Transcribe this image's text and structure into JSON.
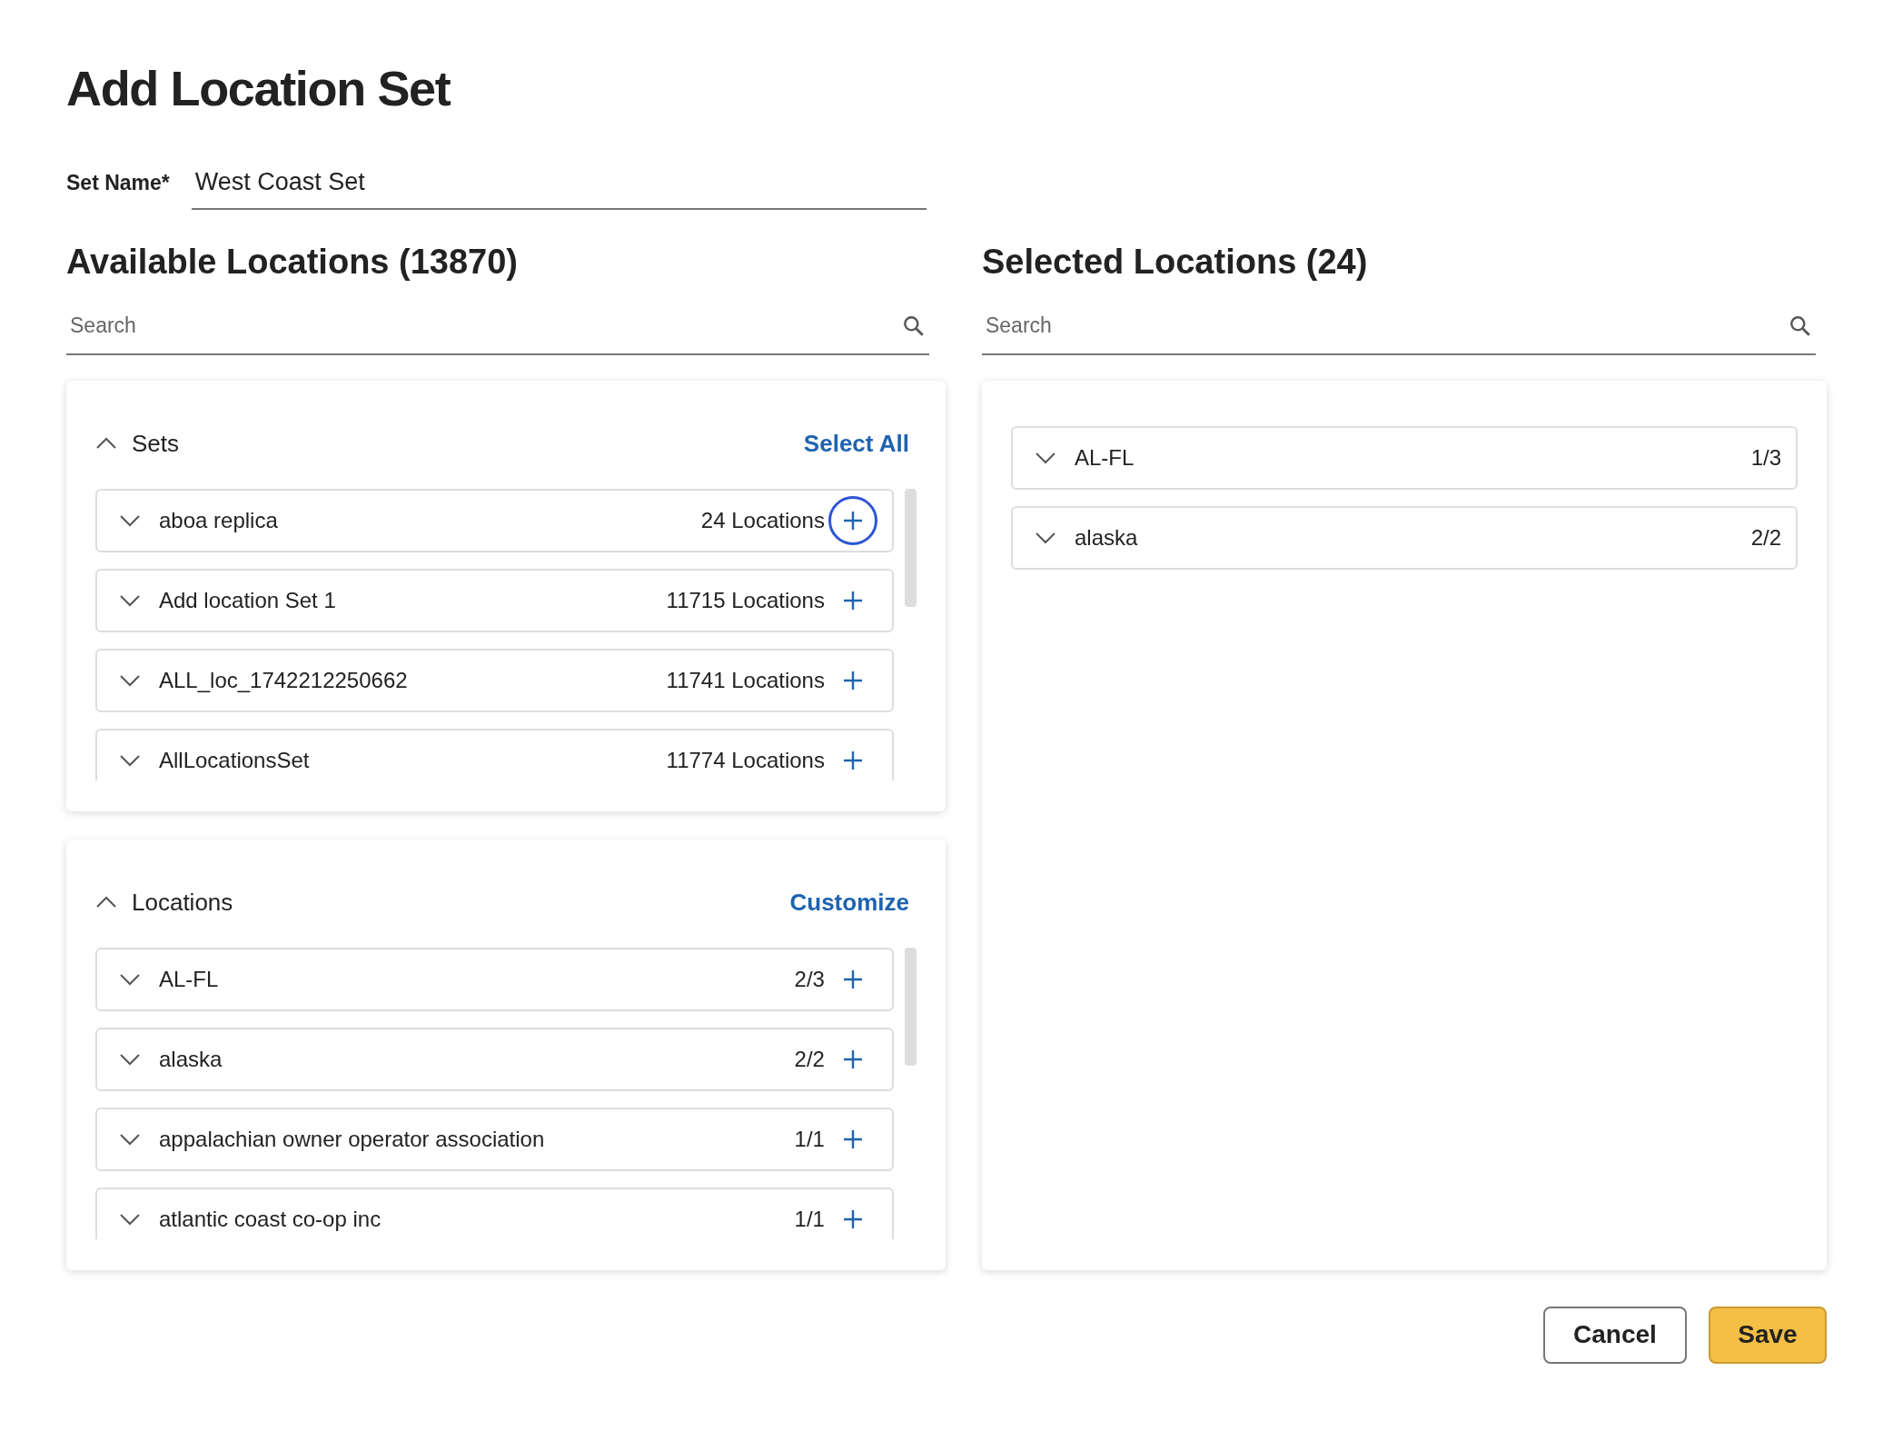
{
  "title": "Add Location Set",
  "set_name": {
    "label": "Set Name*",
    "value": "West Coast Set"
  },
  "available": {
    "heading": "Available Locations (13870)",
    "search": {
      "placeholder": "Search"
    },
    "sections": [
      {
        "title": "Sets",
        "expanded": true,
        "action": "Select All",
        "items": [
          {
            "name": "aboa replica",
            "count": "24 Locations",
            "expanded": false,
            "focused": true
          },
          {
            "name": "Add location Set 1",
            "count": "11715 Locations",
            "expanded": false,
            "focused": false
          },
          {
            "name": "ALL_loc_1742212250662",
            "count": "11741 Locations",
            "expanded": false,
            "focused": false
          },
          {
            "name": "AllLocationsSet",
            "count": "11774 Locations",
            "expanded": false,
            "focused": false
          }
        ]
      },
      {
        "title": "Locations",
        "expanded": true,
        "action": "Customize",
        "items": [
          {
            "name": "AL-FL",
            "count": "2/3",
            "expanded": false,
            "focused": false
          },
          {
            "name": "alaska",
            "count": "2/2",
            "expanded": false,
            "focused": false
          },
          {
            "name": "appalachian owner operator association",
            "count": "1/1",
            "expanded": false,
            "focused": false
          },
          {
            "name": "atlantic coast co-op inc",
            "count": "1/1",
            "expanded": false,
            "focused": false
          }
        ]
      }
    ]
  },
  "selected": {
    "heading": "Selected Locations (24)",
    "search": {
      "placeholder": "Search"
    },
    "items": [
      {
        "name": "AL-FL",
        "count": "1/3",
        "expanded": false
      },
      {
        "name": "alaska",
        "count": "2/2",
        "expanded": false
      }
    ]
  },
  "buttons": [
    {
      "label": "Cancel",
      "kind": "secondary"
    },
    {
      "label": "Save",
      "kind": "primary"
    }
  ]
}
